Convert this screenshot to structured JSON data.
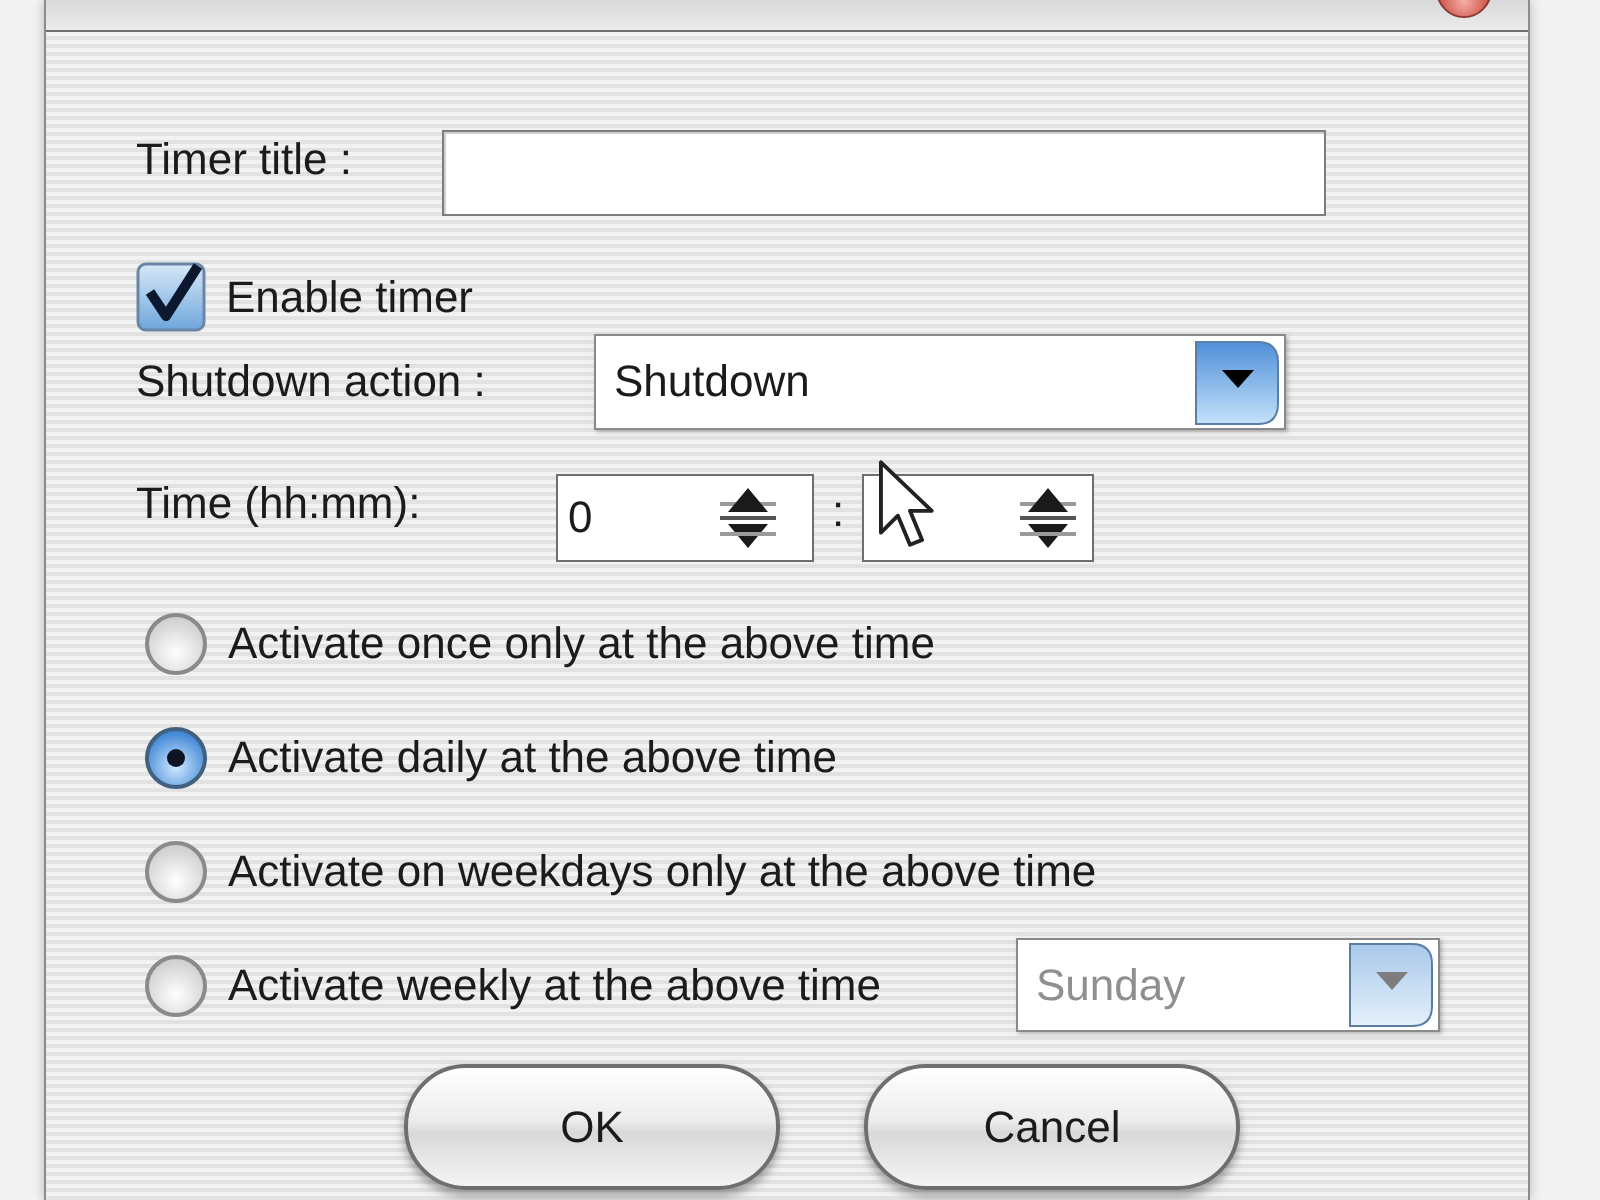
{
  "form": {
    "timer_title": {
      "label": "Timer title :"
    },
    "enable_timer": {
      "label": "Enable timer",
      "checked": true
    },
    "shutdown_action": {
      "label": "Shutdown action :",
      "value": "Shutdown"
    },
    "time": {
      "label": "Time (hh:mm):",
      "hours": "0",
      "separator": ":"
    },
    "schedule": [
      {
        "label": "Activate once only at the above time",
        "selected": false
      },
      {
        "label": "Activate daily at the above time",
        "selected": true
      },
      {
        "label": "Activate on weekdays only at the above time",
        "selected": false
      },
      {
        "label": "Activate weekly at the above time",
        "selected": false,
        "day": {
          "value": "Sunday",
          "disabled": true
        }
      }
    ]
  },
  "buttons": [
    {
      "label": "OK"
    },
    {
      "label": "Cancel"
    }
  ]
}
